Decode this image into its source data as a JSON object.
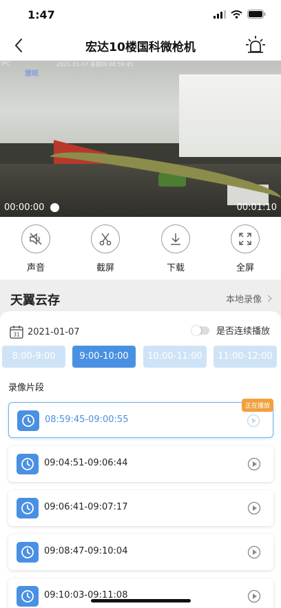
{
  "status_bar": {
    "time": "1:47"
  },
  "nav": {
    "title": "宏达10楼国科微枪机"
  },
  "video": {
    "osd_logo": "IPC",
    "osd_text": "2021-01-07  星期四  08:59:45",
    "brand": "慧眼",
    "time_elapsed": "00:00:00",
    "time_total": "00:01:10",
    "progress": 0.0
  },
  "actions": [
    {
      "label": "声音",
      "icon": "sound-muted-icon"
    },
    {
      "label": "截屏",
      "icon": "scissors-icon"
    },
    {
      "label": "下载",
      "icon": "download-icon"
    },
    {
      "label": "全屏",
      "icon": "fullscreen-icon"
    }
  ],
  "cloud": {
    "title": "天翼云存",
    "local_link": "本地录像",
    "date": "2021-01-07",
    "calendar_day": "31",
    "continuous_label": "是否连续播放",
    "continuous_on": false,
    "time_tabs": [
      "8:00-9:00",
      "9:00-10:00",
      "10:00-11:00",
      "11:00-12:00"
    ],
    "active_tab": 1,
    "segments_label": "录像片段",
    "playing_badge": "正在播放",
    "recordings": [
      {
        "time": "08:59:45-09:00:55",
        "active": true
      },
      {
        "time": "09:04:51-09:06:44",
        "active": false
      },
      {
        "time": "09:06:41-09:07:17",
        "active": false
      },
      {
        "time": "09:08:47-09:10:04",
        "active": false
      },
      {
        "time": "09:10:03-09:11:08",
        "active": false
      }
    ]
  },
  "colors": {
    "accent": "#4a90e2",
    "tab_inactive": "#cfe3f7",
    "badge": "#f2a03d"
  }
}
